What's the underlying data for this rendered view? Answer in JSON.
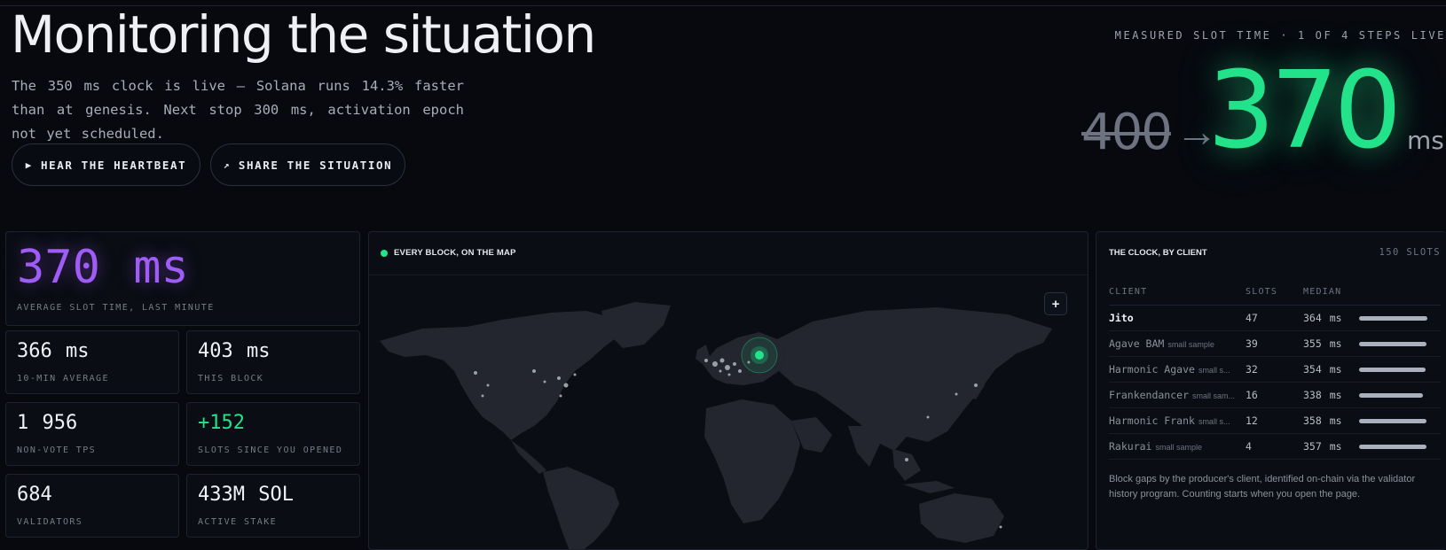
{
  "hero": {
    "title": "Monitoring the situation",
    "subtitle": "The 350 ms clock is live — Solana runs 14.3% faster than at genesis. Next stop 300 ms, activation epoch not yet scheduled.",
    "buttons": [
      {
        "icon": "play-icon",
        "glyph": "▶",
        "label": "HEAR THE HEARTBEAT"
      },
      {
        "icon": "arrow-up-right-icon",
        "glyph": "↗",
        "label": "SHARE THE SITUATION"
      }
    ]
  },
  "measured": {
    "label": "MEASURED SLOT TIME · 1 OF 4 STEPS LIVE",
    "previous": "400",
    "arrow": "→",
    "current": "370",
    "unit": "ms",
    "accent": "#22e38a"
  },
  "stats": {
    "main": {
      "value": "370 ms",
      "label": "AVERAGE SLOT TIME, LAST MINUTE",
      "color": "#9f5cf6"
    },
    "cards": [
      {
        "value": "366 ms",
        "label": "10-MIN AVERAGE",
        "color": "#f0f2f5"
      },
      {
        "value": "403 ms",
        "label": "THIS BLOCK",
        "color": "#f0f2f5"
      },
      {
        "value": "1 956",
        "label": "NON-VOTE TPS",
        "color": "#f0f2f5"
      },
      {
        "value": "+152",
        "label": "SLOTS SINCE YOU OPENED",
        "color": "#22e38a"
      },
      {
        "value": "684",
        "label": "VALIDATORS",
        "color": "#f0f2f5"
      },
      {
        "value": "433M SOL",
        "label": "ACTIVE STAKE",
        "color": "#f0f2f5"
      }
    ]
  },
  "map": {
    "title": "EVERY BLOCK, ON THE MAP",
    "zoom_in": "+",
    "live_color": "#22e38a"
  },
  "clients": {
    "title": "THE CLOCK, BY CLIENT",
    "count": "150 SLOTS",
    "columns": [
      "CLIENT",
      "SLOTS",
      "MEDIAN"
    ],
    "rows": [
      {
        "name": "Jito",
        "note": "",
        "slots": "47",
        "median": "364 ms",
        "bar": 0.99,
        "highlight": true
      },
      {
        "name": "Agave BAM",
        "note": "small sample",
        "slots": "39",
        "median": "355 ms",
        "bar": 0.97,
        "highlight": false
      },
      {
        "name": "Harmonic Agave",
        "note": "small s...",
        "slots": "32",
        "median": "354 ms",
        "bar": 0.96,
        "highlight": false
      },
      {
        "name": "Frankendancer",
        "note": "small sam...",
        "slots": "16",
        "median": "338 ms",
        "bar": 0.92,
        "highlight": false
      },
      {
        "name": "Harmonic Frank",
        "note": "small s...",
        "slots": "12",
        "median": "358 ms",
        "bar": 0.97,
        "highlight": false
      },
      {
        "name": "Rakurai",
        "note": "small sample",
        "slots": "4",
        "median": "357 ms",
        "bar": 0.97,
        "highlight": false
      }
    ],
    "footnote": "Block gaps by the producer's client, identified on-chain via the validator history program. Counting starts when you open the page."
  }
}
